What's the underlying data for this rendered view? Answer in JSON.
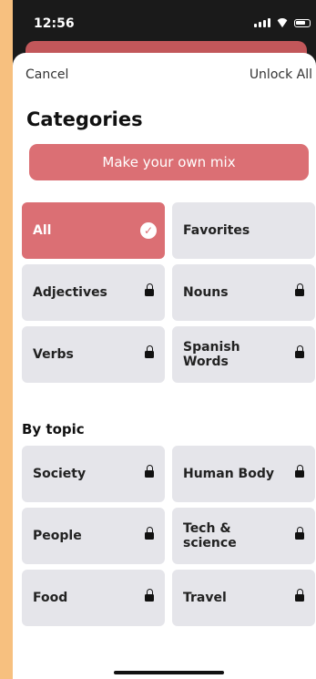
{
  "status_bar": {
    "time": "12:56"
  },
  "header": {
    "cancel_label": "Cancel",
    "unlock_all_label": "Unlock All"
  },
  "page_title": "Categories",
  "mix_button_label": "Make your own mix",
  "categories": [
    {
      "label": "All",
      "selected": true,
      "locked": false
    },
    {
      "label": "Favorites",
      "selected": false,
      "locked": false
    },
    {
      "label": "Adjectives",
      "selected": false,
      "locked": true
    },
    {
      "label": "Nouns",
      "selected": false,
      "locked": true
    },
    {
      "label": "Verbs",
      "selected": false,
      "locked": true
    },
    {
      "label": "Spanish Words",
      "selected": false,
      "locked": true
    }
  ],
  "topic_section_label": "By topic",
  "topics": [
    {
      "label": "Society",
      "locked": true
    },
    {
      "label": "Human Body",
      "locked": true
    },
    {
      "label": "People",
      "locked": true
    },
    {
      "label": "Tech & science",
      "locked": true
    },
    {
      "label": "Food",
      "locked": true
    },
    {
      "label": "Travel",
      "locked": true
    }
  ],
  "colors": {
    "accent": "#db6f74",
    "card": "#e5e5ea",
    "background": "#f7c07f"
  }
}
